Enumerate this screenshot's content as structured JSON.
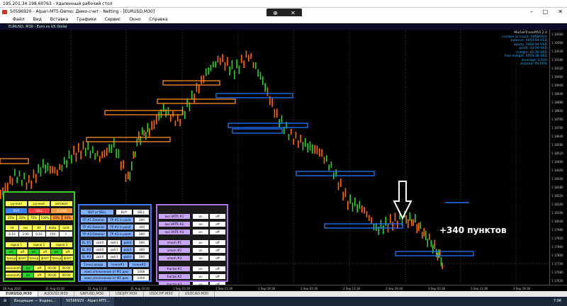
{
  "rdp_title": "195.201.34.198:60763 - Удаленный рабочий стол",
  "window_title": "50596920 - Alpari-MT5-Demo: Демо-счет - Netting - [EURUSD,M30]",
  "menu": [
    "Файл",
    "Вид",
    "Вставка",
    "Графики",
    "Сервис",
    "Окно",
    "Справка"
  ],
  "chart_title": "EURUSD, M30 : Euro vs US Dollar",
  "info": {
    "title": "MarketTradePRO 2.0",
    "lines": [
      "number account: 50596920",
      "balance: 4954.94 USD",
      "equity: 5000.94 USD",
      "profit: 44.00 USD",
      "margin: 41.76 USD",
      "free margin: 4959.18 USD",
      "leverage: 1:500",
      "stopout: 60.00%"
    ]
  },
  "yaxis": [
    "1.19360",
    "1.19300",
    "1.19240",
    "1.19180",
    "1.19120",
    "1.19060",
    "1.19000",
    "1.18940",
    "1.18880",
    "1.18820",
    "1.18760",
    "1.18700",
    "1.18640",
    "1.18580",
    "1.18520",
    "1.18460",
    "1.18400",
    "1.18340",
    "1.18280",
    "1.18220",
    "1.18160",
    "1.18100",
    "1.18040",
    "1.17980",
    "1.17920",
    "1.17860",
    "1.17800",
    "1.17740",
    "1.17680",
    "1.17620"
  ],
  "xaxis": [
    "28 Aug 2020",
    "31 Aug 03:30",
    "31 Aug 11:30",
    "31 Aug 19:30",
    "1 Sep 03:30",
    "1 Sep 11:30",
    "1 Sep 19:30",
    "2 Sep 03:30",
    "2 Sep 11:30",
    "2 Sep 19:30",
    "3 Sep 03:30",
    "3 Sep 11:30",
    "3 Sep 19:30"
  ],
  "tabs": [
    "EURUSD,M30",
    "AUDUSD,M30",
    "GBPUSD,M30",
    "USDJPY,M30",
    "USDCHF,M30",
    "USDCAD,M30"
  ],
  "taskbar": [
    "Входящие — Яндекс...",
    "50596920 - Alpari-MT5..."
  ],
  "clock": "7:06",
  "annotation": "+340 пунктов",
  "panel_green": {
    "row1": [
      "ручная",
      "ручной",
      "автомат"
    ],
    "row2": [
      "BUY",
      "SELL",
      "CLOSE"
    ],
    "row3": [
      "25%",
      "50%",
      "75%",
      "100%",
      "25%",
      "50%"
    ],
    "row4": [
      "lot",
      "sss",
      "ttt",
      "delta",
      "limit"
    ],
    "row5": [
      "0.10",
      "2.00",
      "0.03",
      "150",
      "1"
    ],
    "row6": [
      "signal 1",
      "signal 2",
      "signal 3"
    ],
    "row7": [
      "on",
      "off",
      "on",
      "off",
      "on",
      "off"
    ],
    "row8": [
      "тренд",
      "флет",
      "тренд",
      "флет",
      "тренд",
      "флет"
    ],
    "row9": [
      "session#1",
      "on",
      "off",
      "00:00",
      "00:00"
    ],
    "row10": [
      "session#2",
      "on",
      "off",
      "00:00",
      "00:00"
    ]
  },
  "panel_blue": {
    "row1": [
      "BUY or SELL",
      "BUY",
      "SELL"
    ],
    "row2": [
      "TP #1 Dinamic",
      "TP #1 in point",
      "300"
    ],
    "row3": [
      "TP #2 Dinamic",
      "TP #2 in point",
      "300"
    ],
    "row4": [
      "TP #3 Dinamic",
      "TP #3 in point",
      "300"
    ],
    "row5": [
      "SL #1",
      "vatr0",
      "vatr1",
      "point",
      "300"
    ],
    "row6": [
      "SL #2",
      "vatr0",
      "vatr1",
      "point",
      "300"
    ],
    "row7": [
      "SL #3",
      "vatr0",
      "vatr1",
      "point",
      "300"
    ],
    "row8": [
      "Точка входа",
      "точка#1",
      "точка#2"
    ],
    "row9": [
      "макс.отклонение от М1 дни",
      "1000"
    ],
    "row10": [
      "макс.отклонение от М1 дни",
      "1000"
    ]
  },
  "panel_violet": {
    "rows": [
      [
        "exc.VATR #1",
        "on",
        "off"
      ],
      [
        "exc.VATR #2",
        "on",
        "off"
      ],
      [
        "exc.VATR #3",
        "on",
        "off"
      ],
      [
        "smom #1",
        "on",
        "off"
      ],
      [
        "smom #2",
        "on",
        "off"
      ],
      [
        "smom #3",
        "on",
        "off"
      ],
      [
        "fractal #1",
        "on",
        "off"
      ],
      [
        "fractal #2",
        "on",
        "off"
      ],
      [
        "fractal #3",
        "on",
        "off"
      ]
    ]
  }
}
